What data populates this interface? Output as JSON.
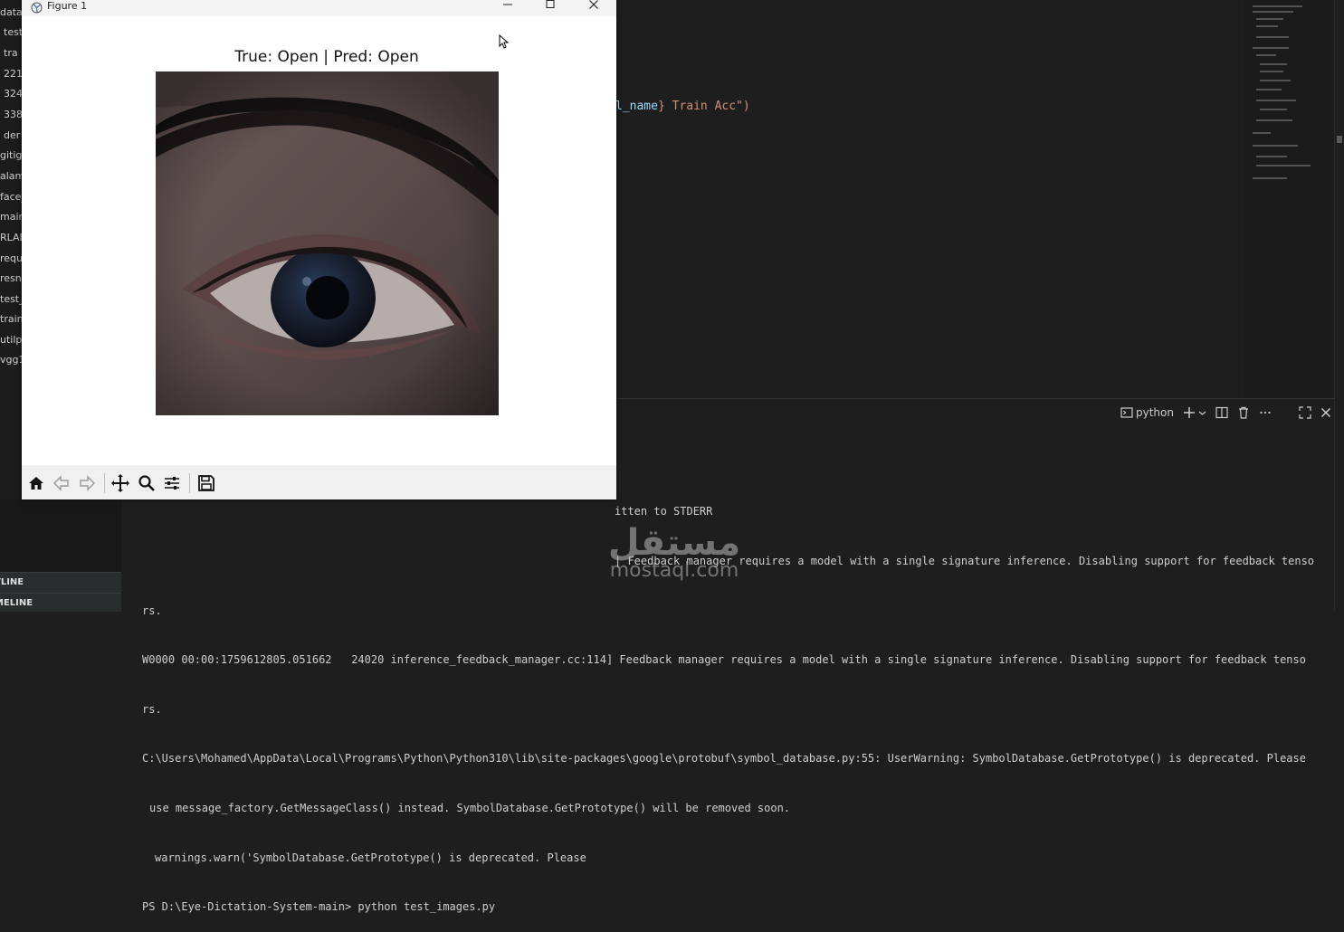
{
  "explorer": {
    "items": [
      "data",
      "test",
      "tra",
      "221",
      "324",
      "338",
      "der",
      "gitig",
      "alam",
      "face_",
      "main",
      "RLAD",
      "requ",
      "resn",
      "test_",
      "train",
      "utilp",
      "vgg1"
    ]
  },
  "panels": {
    "outline": "TLINE",
    "timeline": "MELINE"
  },
  "editor": {
    "line_prefix": "l_name",
    "line_suffix": "} Train Acc\")"
  },
  "terminal_toolbar": {
    "shell_label": "python"
  },
  "terminal_lines": [
    "itten to STDERR",
    "| Feedback manager requires a model with a single signature inference. Disabling support for feedback tenso",
    "rs.",
    "W0000 00:00:1759612805.051662   24020 inference_feedback_manager.cc:114] Feedback manager requires a model with a single signature inference. Disabling support for feedback tenso",
    "rs.",
    "C:\\Users\\Mohamed\\AppData\\Local\\Programs\\Python\\Python310\\lib\\site-packages\\google\\protobuf\\symbol_database.py:55: UserWarning: SymbolDatabase.GetPrototype() is deprecated. Please",
    "use message_factory.GetMessageClass() instead. SymbolDatabase.GetPrototype() will be removed soon.",
    "warnings.warn('SymbolDatabase.GetPrototype() is deprecated. Please",
    "PS D:\\Eye-Dictation-System-main> python test_images.py"
  ],
  "watermark": {
    "arabic": "مستقل",
    "latin": "mostaql.com"
  },
  "figure_window": {
    "title": "Figure 1",
    "plot_title": "True: Open | Pred: Open"
  },
  "toolbar_icons": [
    "home-icon",
    "back-arrow-icon",
    "forward-arrow-icon",
    "pan-icon",
    "zoom-icon",
    "configure-subplots-icon",
    "save-icon"
  ]
}
